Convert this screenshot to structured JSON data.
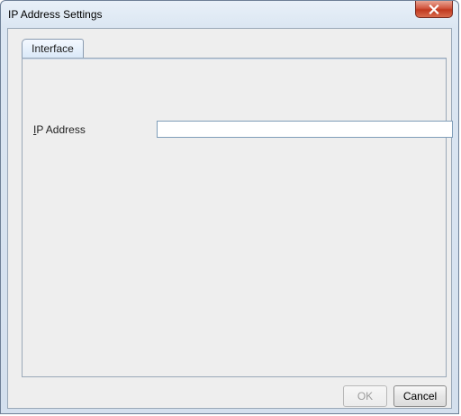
{
  "window": {
    "title": "IP Address Settings",
    "close_icon": "close-icon"
  },
  "tabs": [
    {
      "label": "Interface",
      "selected": true
    }
  ],
  "form": {
    "ip_address": {
      "label_mnemonic": "I",
      "label_rest": "P Address",
      "value": ""
    }
  },
  "buttons": {
    "ok_label": "OK",
    "ok_enabled": false,
    "cancel_label": "Cancel"
  },
  "colors": {
    "close_button": "#c8472e",
    "tab_selected": "#d9e8f8",
    "dialog_background": "#eeeeee"
  }
}
